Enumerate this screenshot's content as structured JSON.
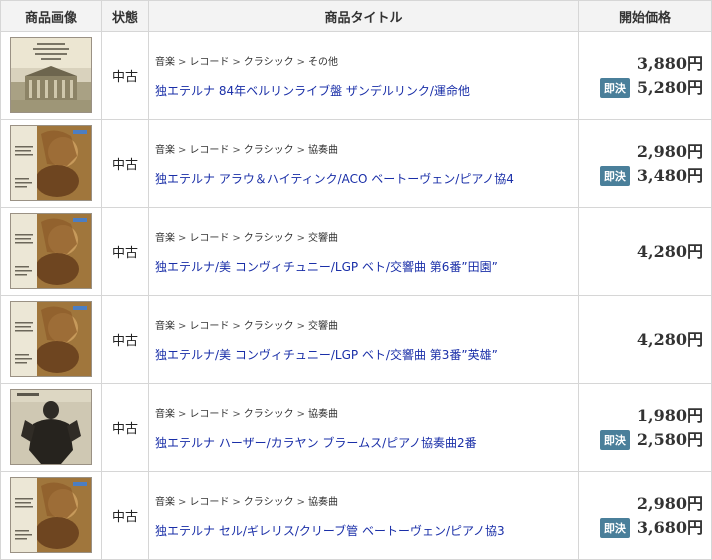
{
  "header": {
    "image_col": "商品画像",
    "condition_col": "状態",
    "title_col": "商品タイトル",
    "price_col": "開始価格"
  },
  "buy_now_badge": "即決",
  "rows": [
    {
      "condition": "中古",
      "breadcrumb": [
        "音楽",
        "レコード",
        "クラシック",
        "その他"
      ],
      "title": "独エテルナ 84年ベルリンライブ盤 ザンデルリンク/運命他",
      "price": "3,880円",
      "buy_now_price": "5,280円",
      "thumb": "concert-hall-cover"
    },
    {
      "condition": "中古",
      "breadcrumb": [
        "音楽",
        "レコード",
        "クラシック",
        "協奏曲"
      ],
      "title": "独エテルナ アラウ＆ハイティンク/ACO ベートーヴェン/ピアノ協4",
      "price": "2,980円",
      "buy_now_price": "3,480円",
      "thumb": "painting-cover"
    },
    {
      "condition": "中古",
      "breadcrumb": [
        "音楽",
        "レコード",
        "クラシック",
        "交響曲"
      ],
      "title": "独エテルナ/美 コンヴィチュニー/LGP ベト/交響曲 第6番”田園”",
      "price": "4,280円",
      "buy_now_price": "",
      "thumb": "painting-cover"
    },
    {
      "condition": "中古",
      "breadcrumb": [
        "音楽",
        "レコード",
        "クラシック",
        "交響曲"
      ],
      "title": "独エテルナ/美 コンヴィチュニー/LGP ベト/交響曲 第3番”英雄”",
      "price": "4,280円",
      "buy_now_price": "",
      "thumb": "painting-cover"
    },
    {
      "condition": "中古",
      "breadcrumb": [
        "音楽",
        "レコード",
        "クラシック",
        "協奏曲"
      ],
      "title": "独エテルナ ハーザー/カラヤン ブラームス/ピアノ協奏曲2番",
      "price": "1,980円",
      "buy_now_price": "2,580円",
      "thumb": "sculpture-cover"
    },
    {
      "condition": "中古",
      "breadcrumb": [
        "音楽",
        "レコード",
        "クラシック",
        "協奏曲"
      ],
      "title": "独エテルナ セル/ギレリス/クリーブ管 ベートーヴェン/ピアノ協3",
      "price": "2,980円",
      "buy_now_price": "3,680円",
      "thumb": "painting-cover"
    }
  ]
}
